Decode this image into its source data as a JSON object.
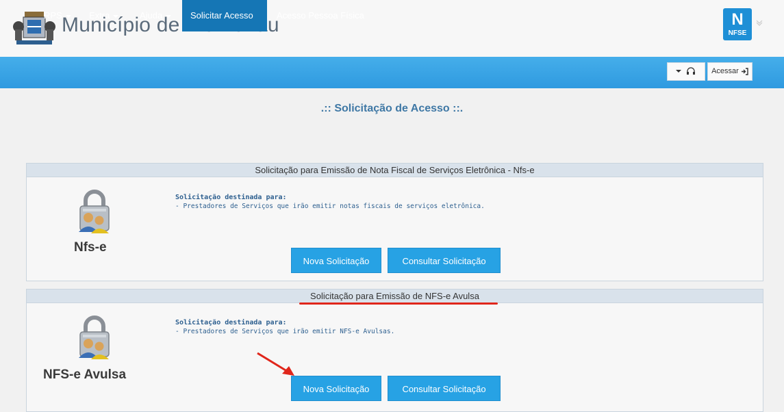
{
  "header": {
    "site_title": "Município de Blumenau",
    "nfse_logo_big": "N",
    "nfse_logo_small": "NFSE"
  },
  "navbar": {
    "items": [
      {
        "label": "RPS",
        "dropdown": true
      },
      {
        "label": "Extra",
        "dropdown": true
      },
      {
        "label": "Ajuda",
        "dropdown": true
      },
      {
        "label": "Solicitar Acesso",
        "active": true
      },
      {
        "label": "Acesso Pessoa Física"
      }
    ],
    "support_icon": "headset-icon",
    "login_label": "Acessar",
    "login_icon": "sign-in-icon"
  },
  "page_heading": ".:: Solicitação de Acesso ::.",
  "panels": [
    {
      "header": "Solicitação para Emissão de Nota Fiscal de Serviços Eletrônica - Nfs-e",
      "name": "Nfs-e",
      "desc_title": "Solicitação destinada para:",
      "desc_line": "- Prestadores de Serviços que irão emitir notas fiscais de serviços eletrônica.",
      "btn_new": "Nova Solicitação",
      "btn_check": "Consultar Solicitação",
      "icon": "lock-users-icon"
    },
    {
      "header": "Solicitação para Emissão de NFS-e Avulsa",
      "name": "NFS-e Avulsa",
      "desc_title": "Solicitação destinada para:",
      "desc_line": "- Prestadores de Serviços que irão emitir NFS-e Avulsas.",
      "btn_new": "Nova Solicitação",
      "btn_check": "Consultar Solicitação",
      "icon": "lock-users-icon"
    }
  ],
  "colors": {
    "navbar": "#3aa6e6",
    "active_nav": "#1576b5",
    "button": "#27a2e4",
    "annotation": "#e0261b"
  }
}
